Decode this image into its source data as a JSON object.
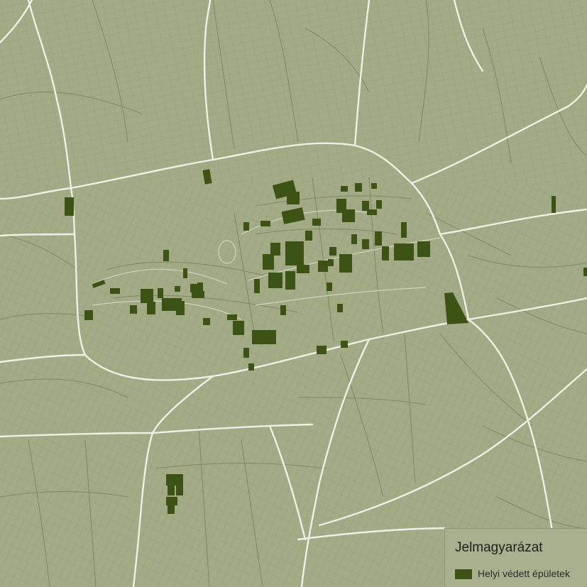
{
  "colors": {
    "background": "#a3ab86",
    "block_lines": "#858d69",
    "main_roads": "#eef0e4",
    "protected_buildings": "#3d5316",
    "legend_background": "#a9b08d"
  },
  "legend": {
    "title": "Jelmagyarázat",
    "items": [
      {
        "label": "Helyi védett épületek",
        "color": "#3d5316"
      }
    ]
  }
}
